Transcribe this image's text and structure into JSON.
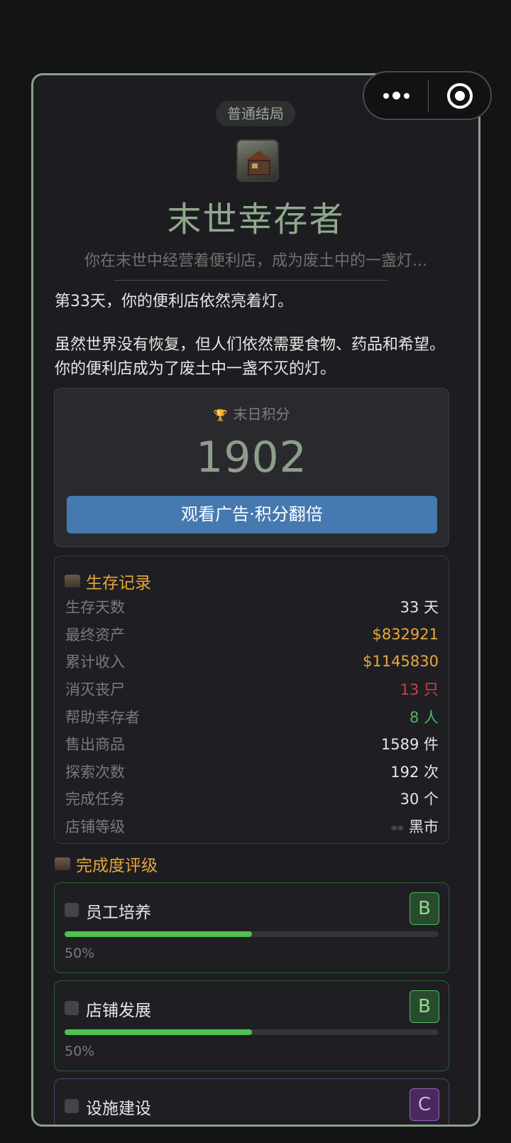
{
  "capsule": {
    "more_icon": "more-dots-icon",
    "close_icon": "target-close-icon"
  },
  "ending": {
    "badge": "普通结局",
    "icon": "ruined-house-icon",
    "title": "末世幸存者",
    "subtitle": "你在末世中经营着便利店，成为废土中的一盏灯...",
    "story": [
      "第33天，你的便利店依然亮着灯。",
      "虽然世界没有恢复，但人们依然需要食物、药品和希望。你的便利店成为了废土中一盏不灭的灯。"
    ]
  },
  "score": {
    "label": "末日积分",
    "value": "1902",
    "double_button": "观看广告·积分翻倍"
  },
  "record": {
    "title": "生存记录",
    "rows": [
      {
        "label": "生存天数",
        "value": "33 天",
        "color": "#e6e6e6"
      },
      {
        "label": "最终资产",
        "value": "$832921",
        "color": "#e6a93a"
      },
      {
        "label": "累计收入",
        "value": "$1145830",
        "color": "#e6a93a"
      },
      {
        "label": "消灭丧尸",
        "value": "13 只",
        "color": "#c94343"
      },
      {
        "label": "帮助幸存者",
        "value": "8 人",
        "color": "#4db85a"
      },
      {
        "label": "售出商品",
        "value": "1589 件",
        "color": "#e6e6e6"
      },
      {
        "label": "探索次数",
        "value": "192 次",
        "color": "#e6e6e6"
      },
      {
        "label": "完成任务",
        "value": "30 个",
        "color": "#e6e6e6"
      },
      {
        "label": "店铺等级",
        "value": "黑市",
        "color": "#e6e6e6"
      }
    ]
  },
  "grades": {
    "title": "完成度评级",
    "items": [
      {
        "name": "员工培养",
        "grade": "B",
        "progress": 0.5,
        "progress_text": "50%"
      },
      {
        "name": "店铺发展",
        "grade": "B",
        "progress": 0.5,
        "progress_text": "50%"
      },
      {
        "name": "设施建设",
        "grade": "C",
        "progress": 0,
        "progress_text": ""
      }
    ]
  },
  "colors": {
    "accent_title": "#8faa8c",
    "section_title": "#e6a43a",
    "button": "#4579b0",
    "progress": "#4fc150"
  }
}
